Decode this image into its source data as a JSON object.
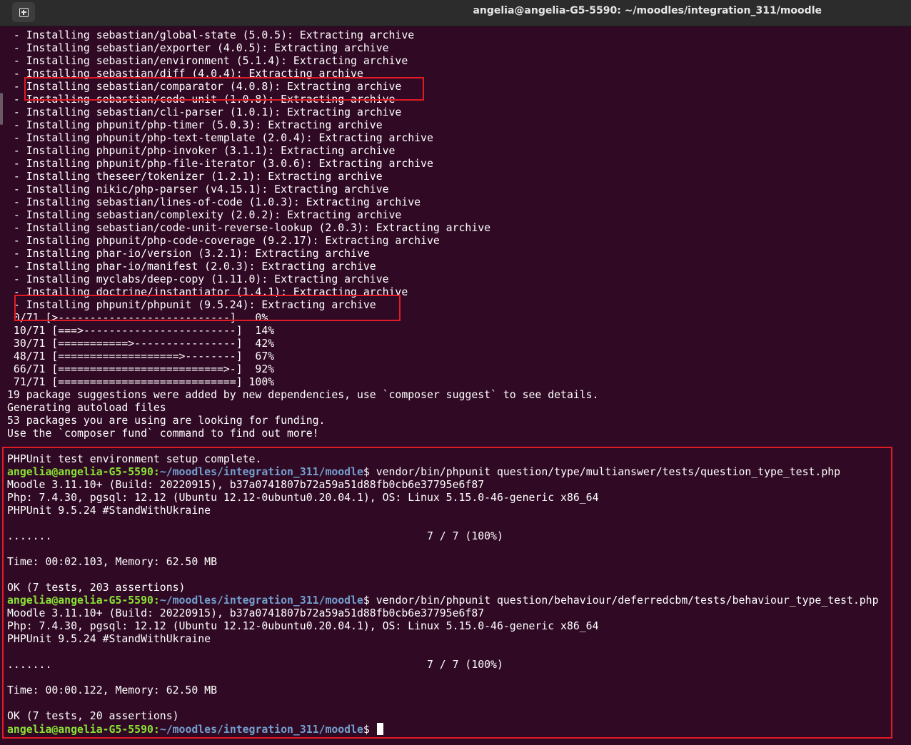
{
  "window": {
    "title": "angelia@angelia-G5-5590: ~/moodles/integration_311/moodle"
  },
  "prompt": {
    "user": "angelia@angelia-G5-5590",
    "path": "~/moodles/integration_311/moodle"
  },
  "lines": [
    " - Installing sebastian/global-state (5.0.5): Extracting archive",
    " - Installing sebastian/exporter (4.0.5): Extracting archive",
    " - Installing sebastian/environment (5.1.4): Extracting archive",
    " - Installing sebastian/diff (4.0.4): Extracting archive",
    " - Installing sebastian/comparator (4.0.8): Extracting archive",
    " - Installing sebastian/code-unit (1.0.8): Extracting archive",
    " - Installing sebastian/cli-parser (1.0.1): Extracting archive",
    " - Installing phpunit/php-timer (5.0.3): Extracting archive",
    " - Installing phpunit/php-text-template (2.0.4): Extracting archive",
    " - Installing phpunit/php-invoker (3.1.1): Extracting archive",
    " - Installing phpunit/php-file-iterator (3.0.6): Extracting archive",
    " - Installing theseer/tokenizer (1.2.1): Extracting archive",
    " - Installing nikic/php-parser (v4.15.1): Extracting archive",
    " - Installing sebastian/lines-of-code (1.0.3): Extracting archive",
    " - Installing sebastian/complexity (2.0.2): Extracting archive",
    " - Installing sebastian/code-unit-reverse-lookup (2.0.3): Extracting archive",
    " - Installing phpunit/php-code-coverage (9.2.17): Extracting archive",
    " - Installing phar-io/version (3.2.1): Extracting archive",
    " - Installing phar-io/manifest (2.0.3): Extracting archive",
    " - Installing myclabs/deep-copy (1.11.0): Extracting archive",
    " - Installing doctrine/instantiator (1.4.1): Extracting archive",
    " - Installing phpunit/phpunit (9.5.24): Extracting archive",
    " 0/71 [>---------------------------]   0%",
    " 10/71 [===>------------------------]  14%",
    " 30/71 [===========>----------------]  42%",
    " 48/71 [===================>--------]  67%",
    " 66/71 [==========================>-]  92%",
    " 71/71 [============================] 100%",
    "19 package suggestions were added by new dependencies, use `composer suggest` to see details.",
    "Generating autoload files",
    "53 packages you are using are looking for funding.",
    "Use the `composer fund` command to find out more!",
    "",
    "PHPUnit test environment setup complete.",
    "$ vendor/bin/phpunit question/type/multianswer/tests/question_type_test.php",
    "Moodle 3.11.10+ (Build: 20220915), b37a0741807b72a59a51d88fb0cb6e37795e6f87",
    "Php: 7.4.30, pgsql: 12.12 (Ubuntu 12.12-0ubuntu0.20.04.1), OS: Linux 5.15.0-46-generic x86_64",
    "PHPUnit 9.5.24 #StandWithUkraine",
    "",
    ".......                                                           7 / 7 (100%)",
    "",
    "Time: 00:02.103, Memory: 62.50 MB",
    "",
    "OK (7 tests, 203 assertions)",
    "$ vendor/bin/phpunit question/behaviour/deferredcbm/tests/behaviour_type_test.php",
    "Moodle 3.11.10+ (Build: 20220915), b37a0741807b72a59a51d88fb0cb6e37795e6f87",
    "Php: 7.4.30, pgsql: 12.12 (Ubuntu 12.12-0ubuntu0.20.04.1), OS: Linux 5.15.0-46-generic x86_64",
    "PHPUnit 9.5.24 #StandWithUkraine",
    "",
    ".......                                                           7 / 7 (100%)",
    "",
    "Time: 00:00.122, Memory: 62.50 MB",
    "",
    "OK (7 tests, 20 assertions)",
    "$ "
  ],
  "colors": {
    "background": "#300a24",
    "prompt_user": "#8ae234",
    "prompt_path": "#729fcf",
    "highlight": "#e01b24"
  },
  "icons": {
    "new_tab": "new-tab-icon"
  }
}
